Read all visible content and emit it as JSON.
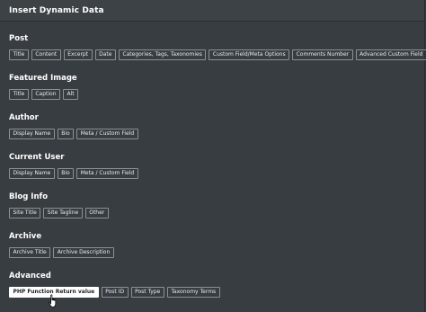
{
  "header": {
    "title": "Insert Dynamic Data"
  },
  "sections": [
    {
      "title": "Post",
      "items": [
        "Title",
        "Content",
        "Excerpt",
        "Date",
        "Categories, Tags, Taxonomies",
        "Custom Field/Meta Options",
        "Comments Number",
        "Advanced Custom Field"
      ]
    },
    {
      "title": "Featured Image",
      "items": [
        "Title",
        "Caption",
        "Alt"
      ]
    },
    {
      "title": "Author",
      "items": [
        "Display Name",
        "Bio",
        "Meta / Custom Field"
      ]
    },
    {
      "title": "Current User",
      "items": [
        "Display Name",
        "Bio",
        "Meta / Custom Field"
      ]
    },
    {
      "title": "Blog Info",
      "items": [
        "Site Title",
        "Site Tagline",
        "Other"
      ]
    },
    {
      "title": "Archive",
      "items": [
        "Archive Title",
        "Archive Description"
      ]
    },
    {
      "title": "Advanced",
      "items": [
        "PHP Function Return value",
        "Post ID",
        "Post Type",
        "Taxonomy Terms"
      ]
    }
  ],
  "colors": {
    "active_chip": "#ffffff",
    "panel_bg": "#383d42",
    "chip_border": "#8a9096"
  },
  "cursor": {
    "icon": "hand-pointer-icon"
  }
}
